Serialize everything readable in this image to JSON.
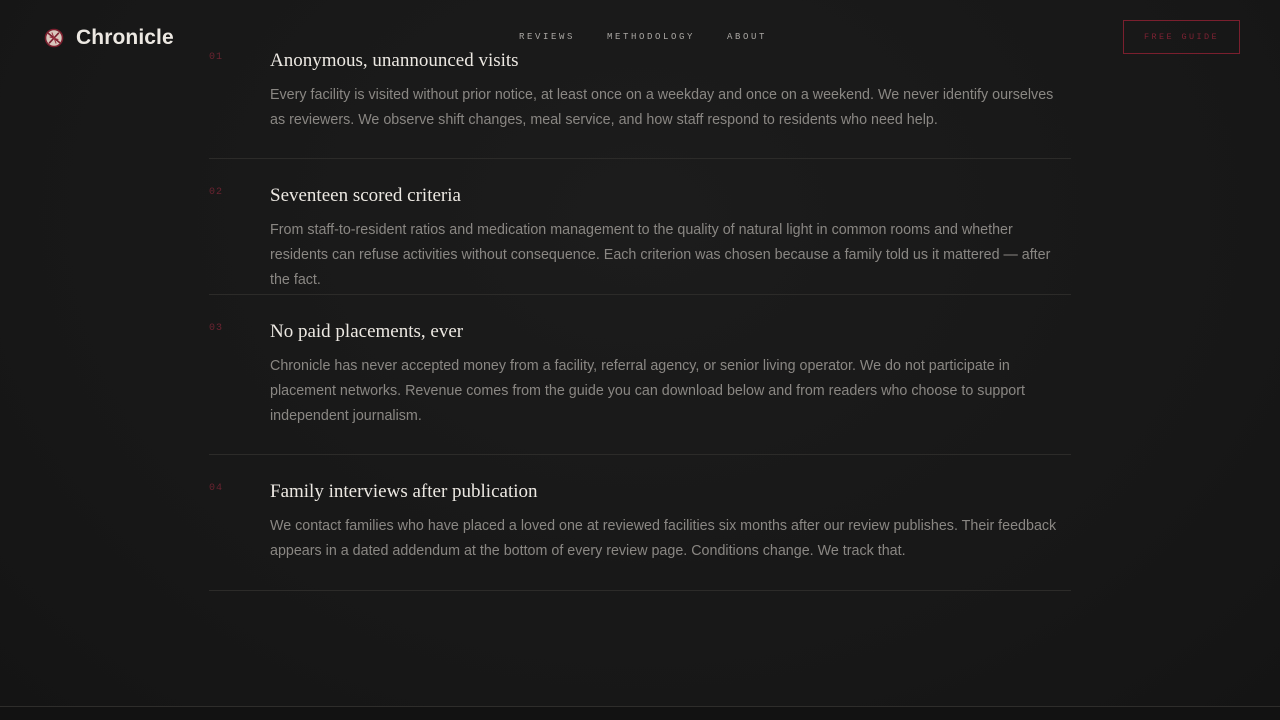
{
  "brand": {
    "name": "Chronicle",
    "icon": "crossed-circle-logo-icon",
    "accent_color": "#7a1f2e"
  },
  "nav": {
    "items": [
      {
        "label": "REVIEWS"
      },
      {
        "label": "METHODOLOGY"
      },
      {
        "label": "ABOUT"
      }
    ],
    "cta_label": "FREE GUIDE"
  },
  "methodology": {
    "items": [
      {
        "number": "01",
        "title": "Anonymous, unannounced visits",
        "body": "Every facility is visited without prior notice, at least once on a weekday and once on a weekend. We never identify ourselves as reviewers. We observe shift changes, meal service, and how staff respond to residents who need help."
      },
      {
        "number": "02",
        "title": "Seventeen scored criteria",
        "body": "From staff-to-resident ratios and medication management to the quality of natural light in common rooms and whether residents can refuse activities without consequence. Each criterion was chosen because a family told us it mattered — after the fact."
      },
      {
        "number": "03",
        "title": "No paid placements, ever",
        "body": "Chronicle has never accepted money from a facility, referral agency, or senior living operator. We do not participate in placement networks. Revenue comes from the guide you can download below and from readers who choose to support independent journalism."
      },
      {
        "number": "04",
        "title": "Family interviews after publication",
        "body": "We contact families who have placed a loved one at reviewed facilities six months after our review publishes. Their feedback appears in a dated addendum at the bottom of every review page. Conditions change. We track that."
      }
    ]
  }
}
